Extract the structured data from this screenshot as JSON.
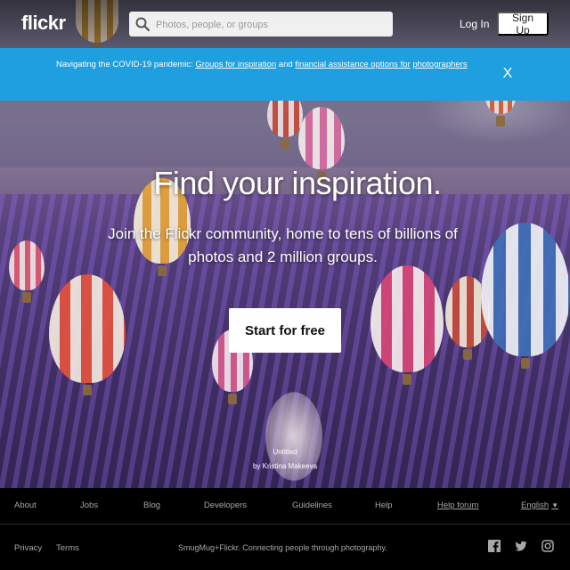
{
  "header": {
    "logo": "flickr",
    "search_placeholder": "Photos, people, or groups",
    "login_label": "Log In",
    "signup_label": "Sign Up"
  },
  "banner": {
    "text_prefix": "Navigating the COVID-19 pandemic:",
    "link_groups": "Groups for inspiration",
    "connector": "and",
    "link_financial": "financial assistance options for",
    "link_photographers": "photographers",
    "close_label": "X"
  },
  "hero": {
    "headline": "Find your inspiration.",
    "subline": "Join the Flickr community, home to tens of billions of photos and 2 million groups.",
    "cta_label": "Start for free",
    "photo_title": "Untitled",
    "photo_author": "by Kristina Makeeva"
  },
  "footer": {
    "links": [
      "About",
      "Jobs",
      "Blog",
      "Developers",
      "Guidelines",
      "Help"
    ],
    "help_forum": "Help forum",
    "language": "English",
    "bottom_links": [
      "Privacy",
      "Terms"
    ],
    "tagline": "SmugMug+Flickr. Connecting people through photography."
  },
  "colors": {
    "banner": "#1f9fe0",
    "footer_bg": "#000000",
    "footer_text": "#a7a7a7"
  },
  "icons": [
    "search-icon",
    "close-icon",
    "facebook-icon",
    "twitter-icon",
    "instagram-icon",
    "chevron-down-icon"
  ]
}
